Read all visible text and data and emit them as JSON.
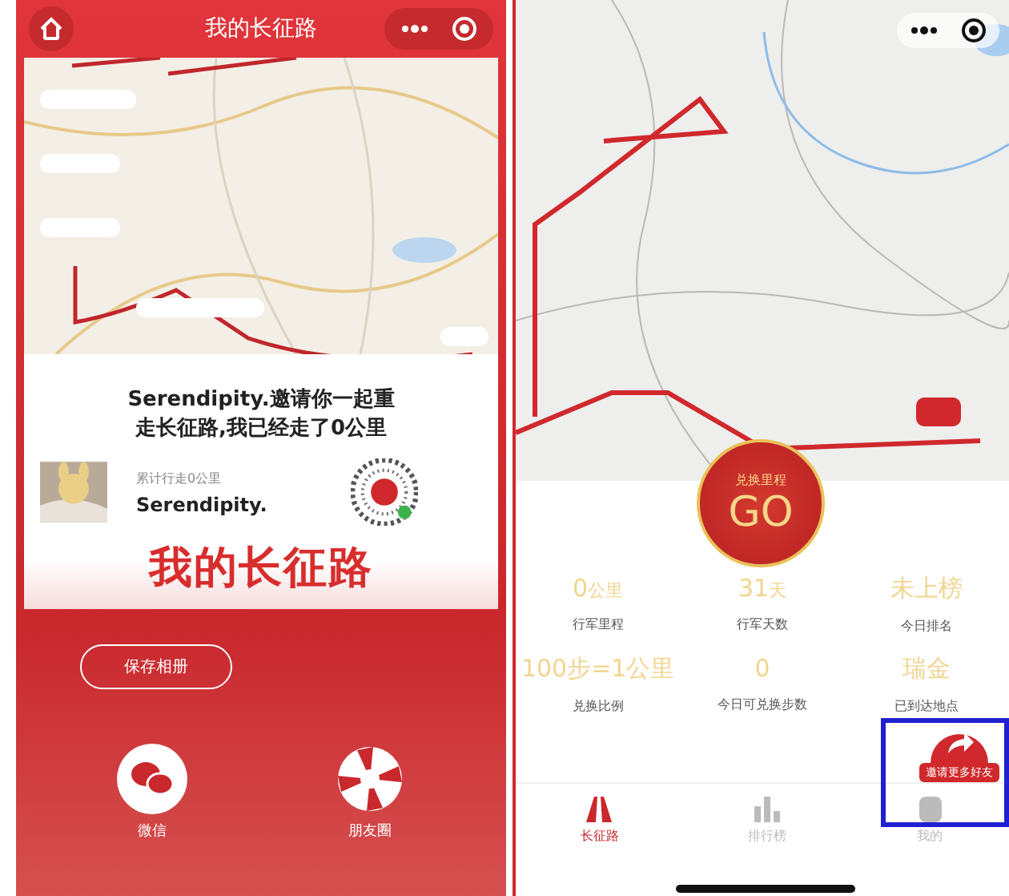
{
  "left": {
    "title": "我的长征路",
    "share_card": {
      "invite_text": "Serendipity.邀请你一起重走长征路,我已经走了0公里",
      "distance_caption": "累计行走0公里",
      "user_name": "Serendipity.",
      "banner_title": "我的长征路"
    },
    "save_button": "保存相册",
    "share_targets": [
      {
        "kind": "wechat",
        "label": "微信"
      },
      {
        "kind": "moments",
        "label": "朋友圈"
      }
    ]
  },
  "right": {
    "go_button": {
      "caption": "兑换里程",
      "label": "GO"
    },
    "stats": [
      {
        "value": "0",
        "unit": "公里",
        "label": "行军里程"
      },
      {
        "value": "31",
        "unit": "天",
        "label": "行军天数"
      },
      {
        "value": "未上榜",
        "label": "今日排名"
      },
      {
        "value": "100步=1公里",
        "label": "兑换比例"
      },
      {
        "value": "0",
        "label": "今日可兑换步数"
      },
      {
        "value": "瑞金",
        "label": "已到达地点"
      }
    ],
    "invite_button": "邀请更多好友",
    "tabs": [
      {
        "label": "长征路",
        "selected": true
      },
      {
        "label": "排行榜",
        "selected": false
      },
      {
        "label": "我的",
        "selected": false
      }
    ]
  }
}
